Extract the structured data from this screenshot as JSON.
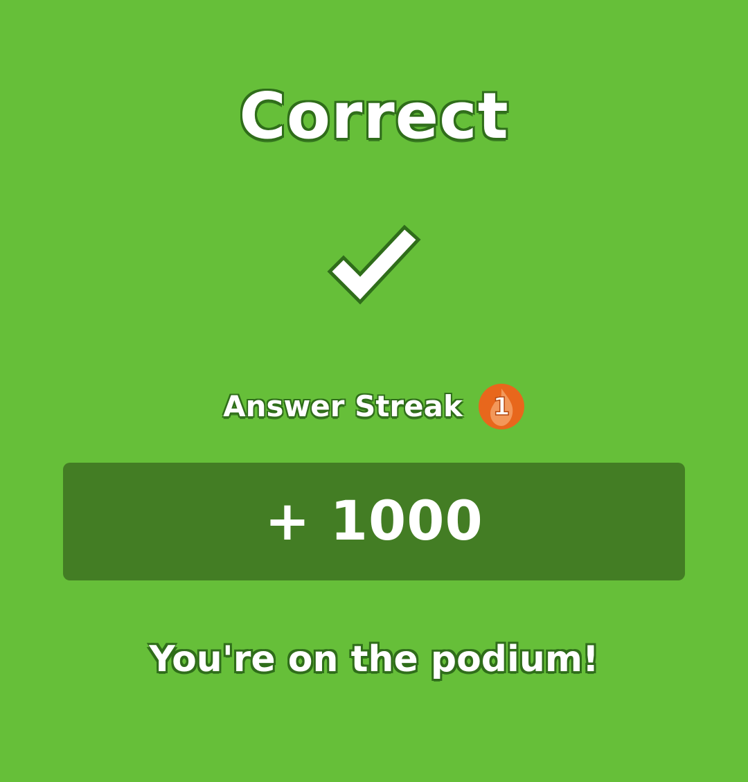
{
  "result": {
    "title": "Correct",
    "status_icon": "checkmark-icon"
  },
  "streak": {
    "label": "Answer Streak",
    "count": "1",
    "badge_icon": "flame-icon",
    "badge_color": "#e8671c"
  },
  "score": {
    "points": "+ 1000"
  },
  "message": "You're on the podium!",
  "colors": {
    "background": "#66bf39",
    "score_panel": "#437d24",
    "text": "#ffffff"
  }
}
